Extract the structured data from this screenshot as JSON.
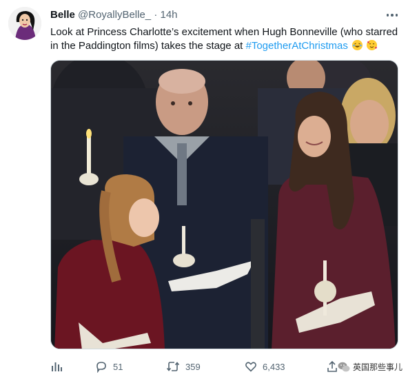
{
  "tweet": {
    "author_name": "Belle",
    "handle": "@RoyallyBelle_",
    "separator": "·",
    "time": "14h",
    "text_before": "Look at Princess Charlotte’s excitement when Hugh Bonneville (who starred in the Paddington films) takes the stage at ",
    "hashtag": "#TogetherAtChristmas",
    "emojis": [
      "laughing-face",
      "smiling-face-with-hearts"
    ],
    "media_alt": "Princess Charlotte at a candlelit Christmas carol service, turning in excitement beside her mother"
  },
  "actions": {
    "analytics_icon": "bar-chart-icon",
    "reply_count": "51",
    "retweet_count": "359",
    "like_count": "6,433"
  },
  "watermark": {
    "text": "英国那些事儿"
  },
  "colors": {
    "hashtag": "#1d9bf0",
    "secondary_text": "#536471",
    "primary_text": "#0f1419"
  }
}
